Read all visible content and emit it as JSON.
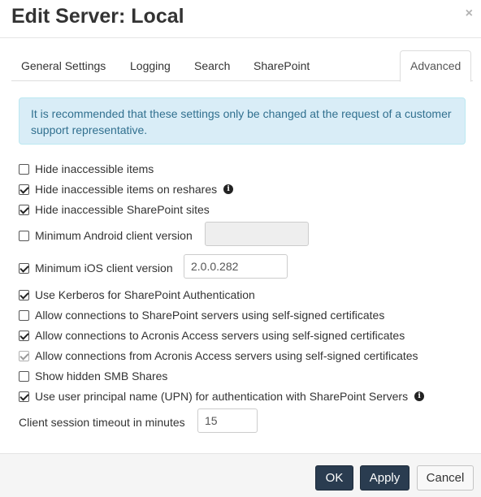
{
  "dialog": {
    "title": "Edit Server: Local",
    "close_glyph": "×"
  },
  "tabs": [
    {
      "label": "General Settings",
      "active": false
    },
    {
      "label": "Logging",
      "active": false
    },
    {
      "label": "Search",
      "active": false
    },
    {
      "label": "SharePoint",
      "active": false
    },
    {
      "label": "Advanced",
      "active": true
    }
  ],
  "alert": {
    "text": "It is recommended that these settings only be changed at the request of a customer support representative."
  },
  "options": [
    {
      "label": "Hide inaccessible items",
      "checked": false,
      "disabled": false
    },
    {
      "label": "Hide inaccessible items on reshares",
      "checked": true,
      "disabled": false,
      "info_icon": "info-circle-icon"
    },
    {
      "label": "Hide inaccessible SharePoint sites",
      "checked": true,
      "disabled": false
    },
    {
      "label": "Minimum Android client version",
      "checked": false,
      "disabled": false,
      "input_value": ""
    },
    {
      "label": "Minimum iOS client version",
      "checked": true,
      "disabled": false,
      "input_value": "2.0.0.282"
    },
    {
      "label": "Use Kerberos for SharePoint Authentication",
      "checked": true,
      "disabled": false
    },
    {
      "label": "Allow connections to SharePoint servers using self-signed certificates",
      "checked": false,
      "disabled": false
    },
    {
      "label": "Allow connections to Acronis Access servers using self-signed certificates",
      "checked": true,
      "disabled": false
    },
    {
      "label": "Allow connections from Acronis Access servers using self-signed certificates",
      "checked": true,
      "disabled": true
    },
    {
      "label": "Show hidden SMB Shares",
      "checked": false,
      "disabled": false
    },
    {
      "label": "Use user principal name (UPN) for authentication with SharePoint Servers",
      "checked": true,
      "disabled": false,
      "info_icon": "info-circle-icon"
    }
  ],
  "timeout": {
    "label": "Client session timeout in minutes",
    "value": "15"
  },
  "footer": {
    "ok_label": "OK",
    "apply_label": "Apply",
    "cancel_label": "Cancel"
  },
  "colors": {
    "alert_bg": "#d9edf7",
    "alert_text": "#31708f",
    "primary_button": "#2a3c50"
  }
}
